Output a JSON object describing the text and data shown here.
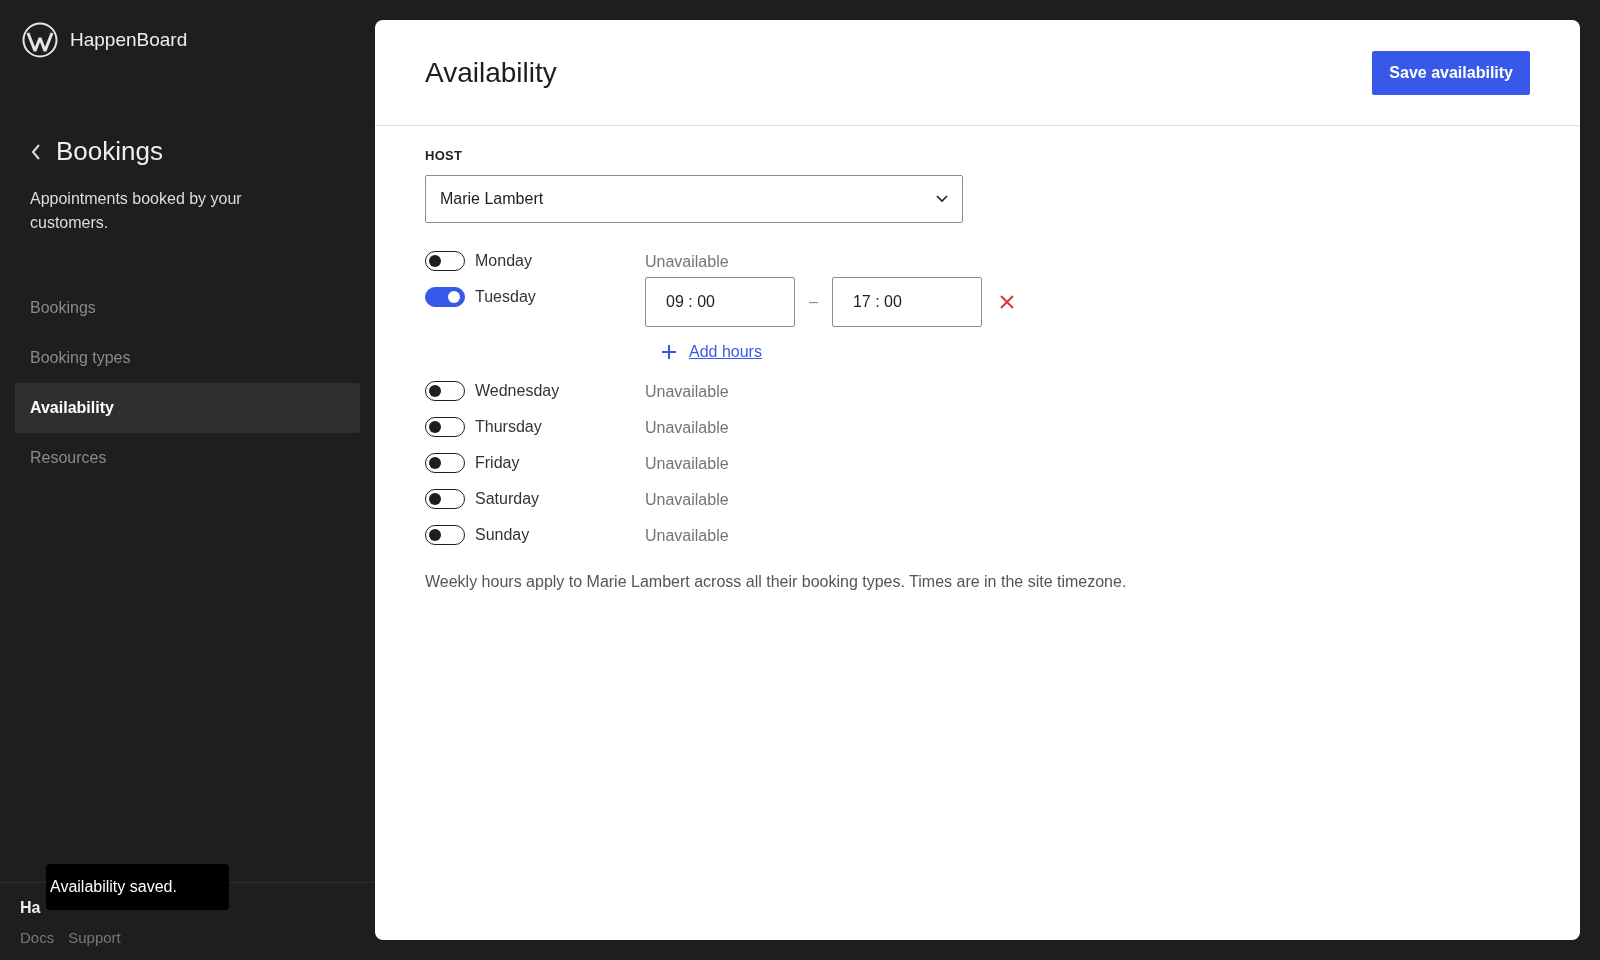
{
  "sidebar": {
    "brand": "HappenBoard",
    "section_title": "Bookings",
    "description": "Appointments booked by your customers.",
    "items": [
      {
        "label": "Bookings",
        "selected": false
      },
      {
        "label": "Booking types",
        "selected": false
      },
      {
        "label": "Availability",
        "selected": true
      },
      {
        "label": "Resources",
        "selected": false
      }
    ],
    "footer": {
      "title": "Ha",
      "links": [
        "Docs",
        "Support"
      ]
    }
  },
  "snackbar": "Availability saved.",
  "page": {
    "title": "Availability",
    "save_button": "Save availability",
    "host": {
      "label": "HOST",
      "value": "Marie Lambert"
    },
    "days": [
      {
        "name": "Monday",
        "on": false,
        "status": "Unavailable"
      },
      {
        "name": "Tuesday",
        "on": true,
        "start": "09 : 00",
        "separator": "–",
        "end": "17 : 00",
        "add_label": "Add hours"
      },
      {
        "name": "Wednesday",
        "on": false,
        "status": "Unavailable"
      },
      {
        "name": "Thursday",
        "on": false,
        "status": "Unavailable"
      },
      {
        "name": "Friday",
        "on": false,
        "status": "Unavailable"
      },
      {
        "name": "Saturday",
        "on": false,
        "status": "Unavailable"
      },
      {
        "name": "Sunday",
        "on": false,
        "status": "Unavailable"
      }
    ],
    "note": "Weekly hours apply to Marie Lambert across all their booking types. Times are in the site timezone."
  }
}
